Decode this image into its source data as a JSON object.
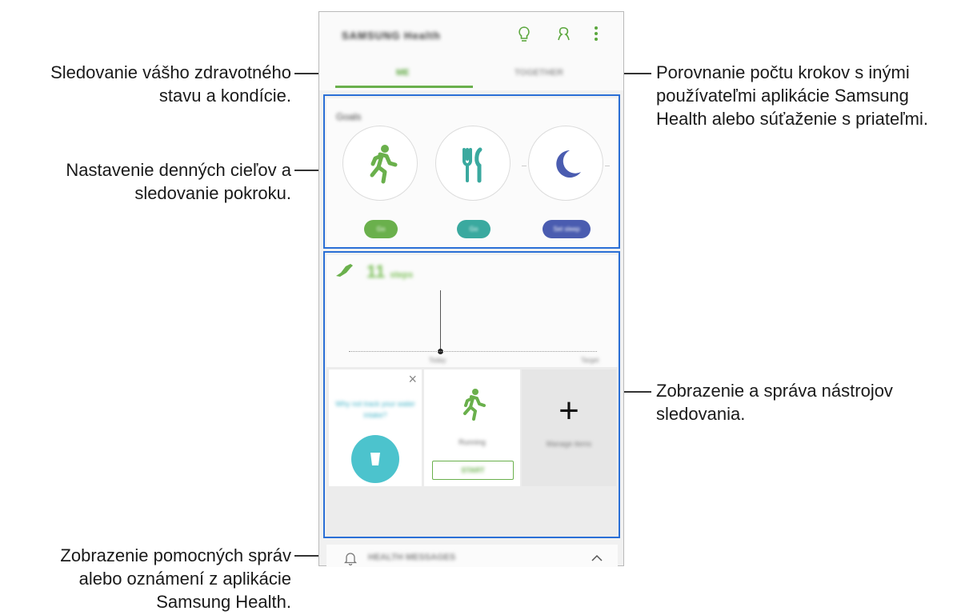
{
  "callouts": {
    "tabs_me": [
      "Sledovanie vášho zdravotného",
      "stavu a kondície."
    ],
    "tabs_together": [
      "Porovnanie počtu krokov s inými",
      "používateľmi aplikácie Samsung",
      "Health alebo súťaženie s priateľmi."
    ],
    "goals": [
      "Nastavenie denných cieľov a",
      "sledovanie pokroku."
    ],
    "trackers": [
      "Zobrazenie a správa nástrojov",
      "sledovania."
    ],
    "messages": [
      "Zobrazenie pomocných správ",
      "alebo oznámení z aplikácie",
      "Samsung Health."
    ]
  },
  "phone": {
    "brand": "SAMSUNG Health",
    "icons": [
      "lightbulb-icon",
      "together-icon",
      "more-vertical-icon"
    ],
    "tabs": [
      "ME",
      "TOGETHER"
    ],
    "goals": {
      "title": "Goals",
      "items": [
        {
          "icon": "running-icon",
          "pill": "Go",
          "color": "#6ab04c"
        },
        {
          "icon": "fork-knife-icon",
          "pill": "Go",
          "color": "#3aa99f"
        },
        {
          "icon": "moon-icon",
          "pill": "Set sleep",
          "color": "#4a5cb0"
        }
      ]
    },
    "steps": {
      "value": "11",
      "unit": "steps",
      "axis_labels": [
        "",
        "",
        "Today",
        "",
        "",
        "",
        "Target"
      ]
    },
    "trackers": {
      "water_text": "Why not track your water intake?",
      "running_label": "Running",
      "start_label": "START",
      "manage_label": "Manage items"
    },
    "messages": {
      "label": "HEALTH MESSAGES"
    },
    "colors": {
      "accent": "#6ab04c",
      "highlight": "#2a6fd6",
      "water": "#4cc3cd"
    }
  }
}
